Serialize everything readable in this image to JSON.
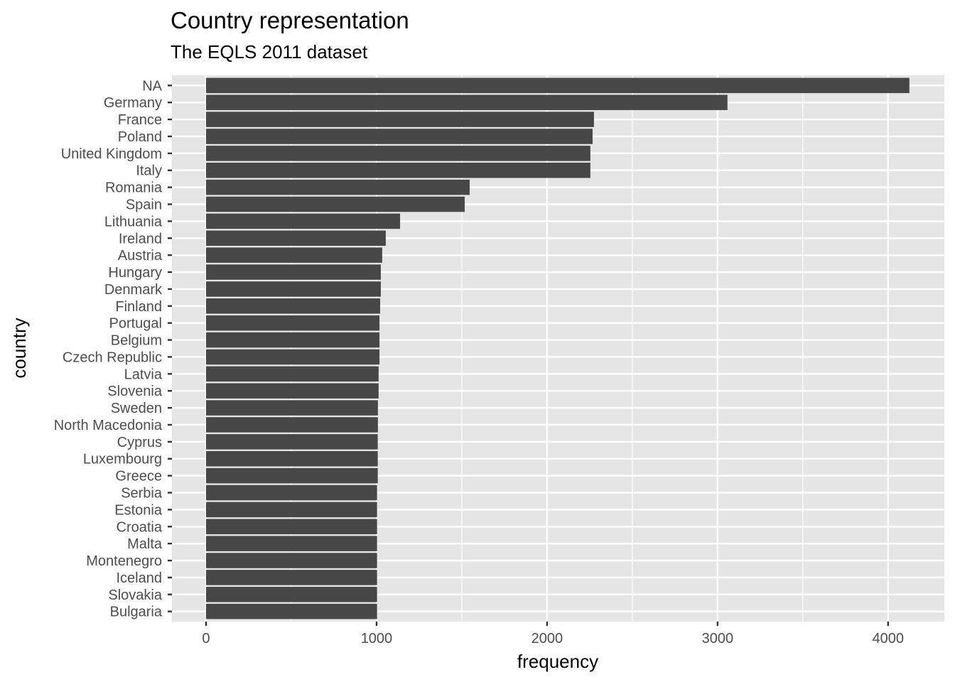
{
  "chart_data": {
    "type": "bar",
    "orientation": "horizontal",
    "title": "Country representation",
    "subtitle": "The EQLS 2011 dataset",
    "xlabel": "frequency",
    "ylabel": "country",
    "xlim": [
      -200,
      4330
    ],
    "xticks": [
      0,
      1000,
      2000,
      3000,
      4000
    ],
    "xtick_labels": [
      "0",
      "1000",
      "2000",
      "3000",
      "4000"
    ],
    "grid": true,
    "legend": "none",
    "colors": {
      "bar": "#474747",
      "panel": "#e5e5e5",
      "grid": "#ffffff"
    },
    "categories": [
      "NA",
      "Germany",
      "France",
      "Poland",
      "United Kingdom",
      "Italy",
      "Romania",
      "Spain",
      "Lithuania",
      "Ireland",
      "Austria",
      "Hungary",
      "Denmark",
      "Finland",
      "Portugal",
      "Belgium",
      "Czech Republic",
      "Latvia",
      "Slovenia",
      "Sweden",
      "North Macedonia",
      "Cyprus",
      "Luxembourg",
      "Greece",
      "Serbia",
      "Estonia",
      "Croatia",
      "Malta",
      "Montenegro",
      "Iceland",
      "Slovakia",
      "Bulgaria"
    ],
    "values": [
      4125,
      3058,
      2275,
      2267,
      2254,
      2254,
      1546,
      1517,
      1138,
      1054,
      1033,
      1025,
      1025,
      1021,
      1017,
      1017,
      1017,
      1012,
      1012,
      1008,
      1008,
      1007,
      1007,
      1007,
      1003,
      1003,
      1003,
      1003,
      1003,
      1003,
      1003,
      1003
    ]
  }
}
